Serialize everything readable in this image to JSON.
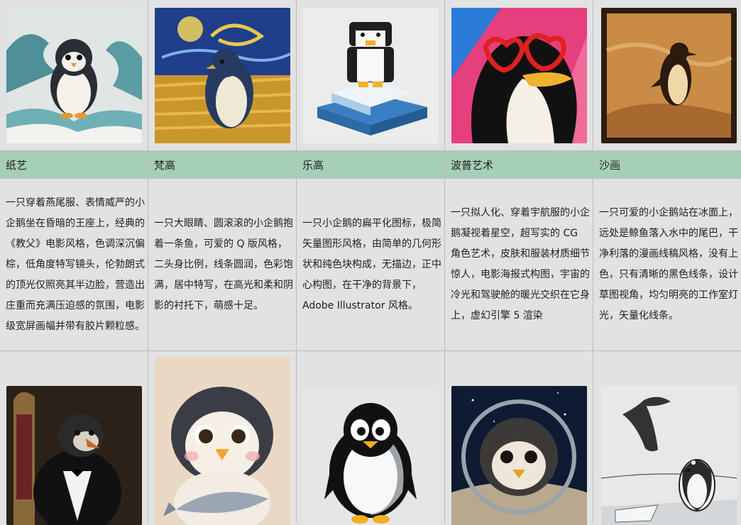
{
  "styles": [
    {
      "label": "纸艺",
      "description": "一只穿着燕尾服、表情威严的小企鹅坐在昏暗的王座上，经典的《教父》电影风格，色调深沉偏棕，低角度特写镜头，伦勃朗式的顶光仅照亮其半边脸，营造出庄重而充满压迫感的氛围，电影级宽屏画幅并带有胶片颗粒感。",
      "top_image": "paper-art-penguin-on-waves",
      "bottom_image": "godfather-penguin-on-throne"
    },
    {
      "label": "梵高",
      "description": "一只大眼睛、圆滚滚的小企鹅抱着一条鱼，可爱的 Q 版风格，二头身比例，线条圆润，色彩饱满，居中特写，在高光和柔和阴影的衬托下，萌感十足。",
      "top_image": "van-gogh-penguin-in-wheat-field",
      "bottom_image": "chibi-penguin-holding-fish"
    },
    {
      "label": "乐高",
      "description": "一只小企鹅的扁平化图标，极简矢量图形风格，由简单的几何形状和纯色块构成，无描边，正中心构图，在干净的背景下，Adobe Illustrator 风格。",
      "top_image": "lego-penguin-on-ice-base",
      "bottom_image": "flat-vector-penguin-icon"
    },
    {
      "label": "波普艺术",
      "description": "一只拟人化、穿着宇航服的小企鹅凝视着星空，超写实的 CG 角色艺术，皮肤和服装材质细节惊人，电影海报式构图，宇宙的冷光和驾驶舱的暖光交织在它身上，虚幻引擎 5 渲染",
      "top_image": "pop-art-penguin-heart-glasses",
      "bottom_image": "astronaut-penguin-in-space"
    },
    {
      "label": "沙画",
      "description": "一只可爱的小企鹅站在冰面上，远处是鲸鱼落入水中的尾巴，干净利落的漫画线稿风格，没有上色，只有清晰的黑色线条，设计草图视角，均匀明亮的工作室灯光，矢量化线条。",
      "top_image": "sand-art-penguin",
      "bottom_image": "sketch-penguin-with-whale-tail"
    }
  ]
}
